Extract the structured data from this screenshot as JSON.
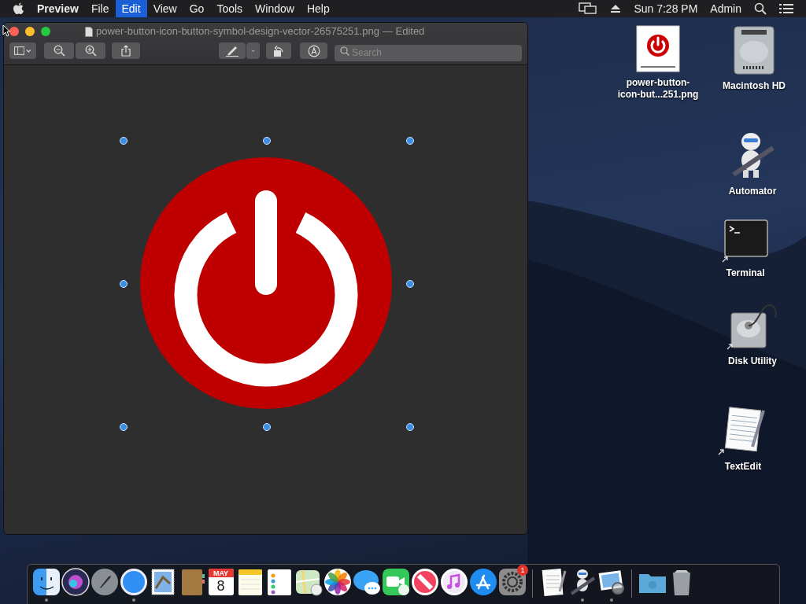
{
  "menubar": {
    "app": "Preview",
    "menus": [
      {
        "label": "File",
        "selected": false
      },
      {
        "label": "Edit",
        "selected": true
      },
      {
        "label": "View",
        "selected": false
      },
      {
        "label": "Go",
        "selected": false
      },
      {
        "label": "Tools",
        "selected": false
      },
      {
        "label": "Window",
        "selected": false
      },
      {
        "label": "Help",
        "selected": false
      }
    ],
    "clock": "Sun 7:28 PM",
    "user": "Admin"
  },
  "window": {
    "title": "power-button-icon-button-symbol-design-vector-26575251.png",
    "edited": "— Edited",
    "search": {
      "placeholder": "Search"
    }
  },
  "desktop_icons": [
    {
      "kind": "image-file",
      "label_lines": [
        "power-button-",
        "icon-but...251.png"
      ]
    },
    {
      "kind": "disk",
      "label_lines": [
        "Macintosh HD"
      ]
    },
    {
      "kind": "automator",
      "label_lines": [
        "Automator"
      ]
    },
    {
      "kind": "terminal",
      "label_lines": [
        "Terminal"
      ]
    },
    {
      "kind": "disk-utility",
      "label_lines": [
        "Disk Utility"
      ]
    },
    {
      "kind": "textedit",
      "label_lines": [
        "TextEdit"
      ]
    }
  ],
  "dock": {
    "items": [
      {
        "kind": "finder",
        "running": true
      },
      {
        "kind": "siri",
        "running": false
      },
      {
        "kind": "launchpad",
        "running": false
      },
      {
        "kind": "safari",
        "running": true
      },
      {
        "kind": "mail",
        "running": false
      },
      {
        "kind": "contacts",
        "running": false
      },
      {
        "kind": "calendar",
        "running": false,
        "month": "MAY",
        "day": "8"
      },
      {
        "kind": "notes",
        "running": false
      },
      {
        "kind": "reminders",
        "running": false
      },
      {
        "kind": "maps",
        "running": false
      },
      {
        "kind": "photos",
        "running": false
      },
      {
        "kind": "messages",
        "running": false
      },
      {
        "kind": "facetime",
        "running": false
      },
      {
        "kind": "news",
        "running": false
      },
      {
        "kind": "music",
        "running": false
      },
      {
        "kind": "appstore",
        "running": false
      },
      {
        "kind": "settings",
        "running": false,
        "badge": "1"
      },
      {
        "kind": "separator"
      },
      {
        "kind": "textedit",
        "running": false
      },
      {
        "kind": "automator",
        "running": true
      },
      {
        "kind": "preview",
        "running": true
      },
      {
        "kind": "separator"
      },
      {
        "kind": "folder",
        "running": false
      },
      {
        "kind": "trash",
        "running": false
      }
    ]
  }
}
